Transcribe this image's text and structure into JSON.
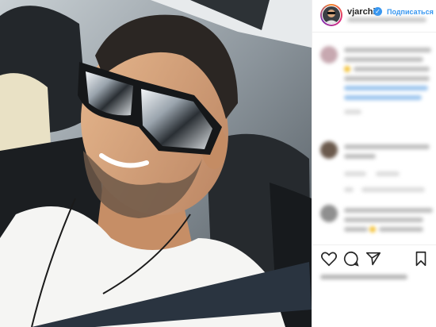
{
  "post": {
    "photo_alt": "",
    "header": {
      "username": "vjarchi",
      "verified_mark": "✓",
      "follow_label": "Подписаться",
      "avatar_icon": "profile-avatar"
    },
    "comments": [
      {
        "avatar_color": "#c7a8b0"
      },
      {
        "avatar_color": "#6b5a4d"
      },
      {
        "avatar_color": "#8f8f8f"
      }
    ],
    "actions": {
      "like_icon": "heart-icon",
      "comment_icon": "comment-icon",
      "share_icon": "share-icon",
      "save_icon": "bookmark-icon"
    },
    "colors": {
      "accent": "#3897f0",
      "text": "#262626",
      "muted": "#8e8e8e"
    }
  }
}
